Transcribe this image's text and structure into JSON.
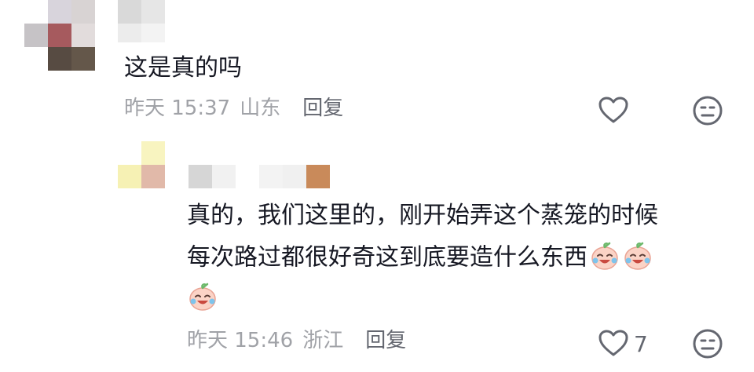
{
  "comment_1": {
    "text": "这是真的吗",
    "time": "昨天 15:37",
    "location": "山东",
    "reply_label": "回复"
  },
  "reply_1": {
    "line_1": "真的，我们这里的，刚开始弄这个蒸笼的时候",
    "line_2": "每次路过都很好奇这到底要造什么东西",
    "emoji": "crying-laughing-emoji",
    "time": "昨天 15:46",
    "location": "浙江",
    "reply_label": "回复",
    "like_count": "7"
  },
  "icons": {
    "like": "heart-outline-icon",
    "dislike": "neutral-face-icon"
  }
}
